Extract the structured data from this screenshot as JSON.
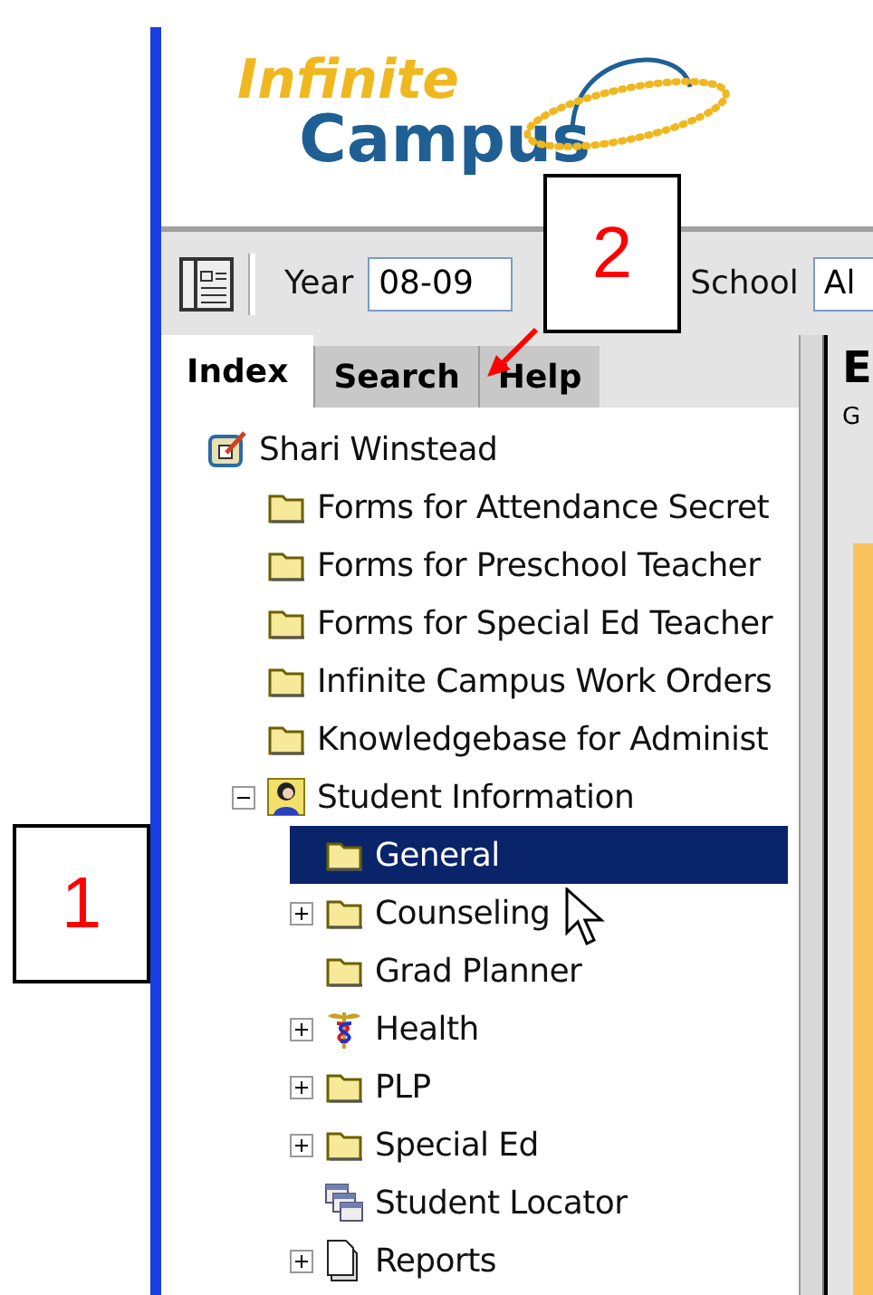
{
  "logo": {
    "line_1": "Infinite",
    "line_2": "Campus"
  },
  "toolbar": {
    "year_label": "Year",
    "year_value": "08-09",
    "school_label": "School",
    "school_value": "Al"
  },
  "tabs": [
    {
      "label": "Index",
      "selected": true
    },
    {
      "label": "Search",
      "selected": false
    },
    {
      "label": "Help",
      "selected": false
    }
  ],
  "tree": [
    {
      "label": "Shari Winstead",
      "kind": "user",
      "selected": false,
      "children": [
        {
          "label": "Forms for Attendance Secret",
          "kind": "folder",
          "selected": false
        },
        {
          "label": "Forms for Preschool Teacher",
          "kind": "folder",
          "selected": false
        },
        {
          "label": "Forms for Special Ed Teacher",
          "kind": "folder",
          "selected": false
        },
        {
          "label": "Infinite Campus Work Orders",
          "kind": "folder",
          "selected": false
        },
        {
          "label": "Knowledgebase for Administ",
          "kind": "folder",
          "selected": false
        },
        {
          "label": "Student Information",
          "kind": "student",
          "selected": false,
          "expanded": true,
          "children": [
            {
              "label": "General",
              "kind": "folder",
              "selected": true
            },
            {
              "label": "Counseling",
              "kind": "folder",
              "selected": false,
              "expanded": false
            },
            {
              "label": "Grad Planner",
              "kind": "folder",
              "selected": false
            },
            {
              "label": "Health",
              "kind": "health",
              "selected": false,
              "expanded": false
            },
            {
              "label": "PLP",
              "kind": "folder",
              "selected": false,
              "expanded": false
            },
            {
              "label": "Special Ed",
              "kind": "folder",
              "selected": false,
              "expanded": false
            },
            {
              "label": "Student Locator",
              "kind": "locator",
              "selected": false
            },
            {
              "label": "Reports",
              "kind": "document",
              "selected": false,
              "expanded": false
            }
          ]
        }
      ]
    }
  ],
  "right_pane": {
    "heading": "E",
    "text": "G"
  },
  "callouts": [
    {
      "label": "1"
    },
    {
      "label": "2"
    }
  ]
}
